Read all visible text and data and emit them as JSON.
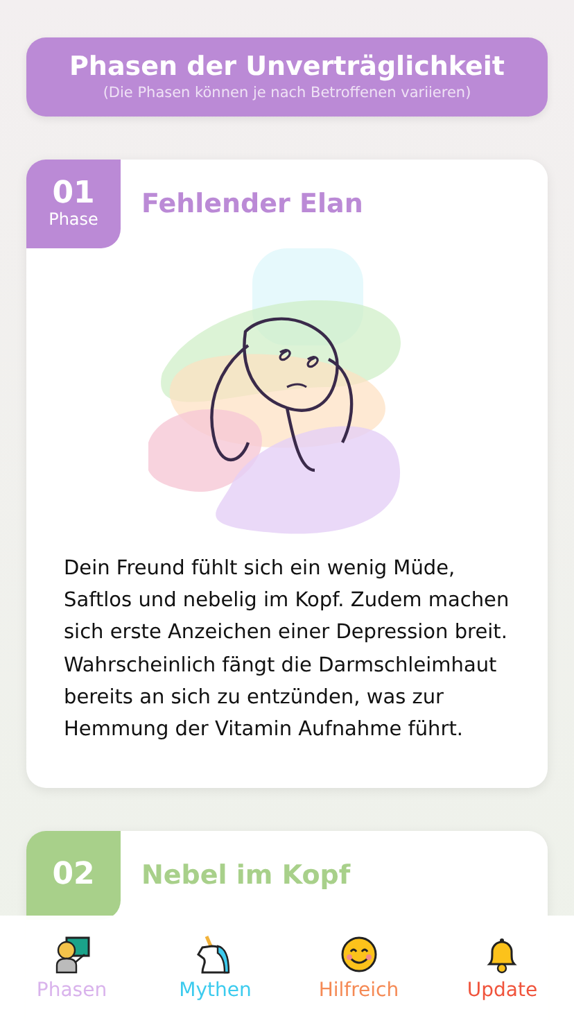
{
  "header": {
    "title": "Phasen der Unverträglichkeit",
    "subtitle": "(Die Phasen können je nach Betroffenen variieren)"
  },
  "phases": [
    {
      "number": "01",
      "label": "Phase",
      "title": "Fehlender Elan",
      "color": "#bb8ad6",
      "text": "Dein Freund fühlt sich ein wenig Müde, Saftlos und nebelig im Kopf. Zudem machen sich erste Anzeichen einer Depression breit. Wahrscheinlich fängt die Darmschleimhaut bereits an sich zu entzünden, was zur Hemmung der Vitamin Aufnahme führt."
    },
    {
      "number": "02",
      "title": "Nebel im Kopf",
      "color": "#a8d08a"
    }
  ],
  "tabs": [
    {
      "label": "Phasen",
      "kind": "teacher",
      "color": "#d9b3ec"
    },
    {
      "label": "Mythen",
      "kind": "unicorn",
      "color": "#3ccbee"
    },
    {
      "label": "Hilfreich",
      "kind": "smiley",
      "color": "#f58a55"
    },
    {
      "label": "Update",
      "kind": "bell",
      "color": "#f0543c"
    }
  ]
}
